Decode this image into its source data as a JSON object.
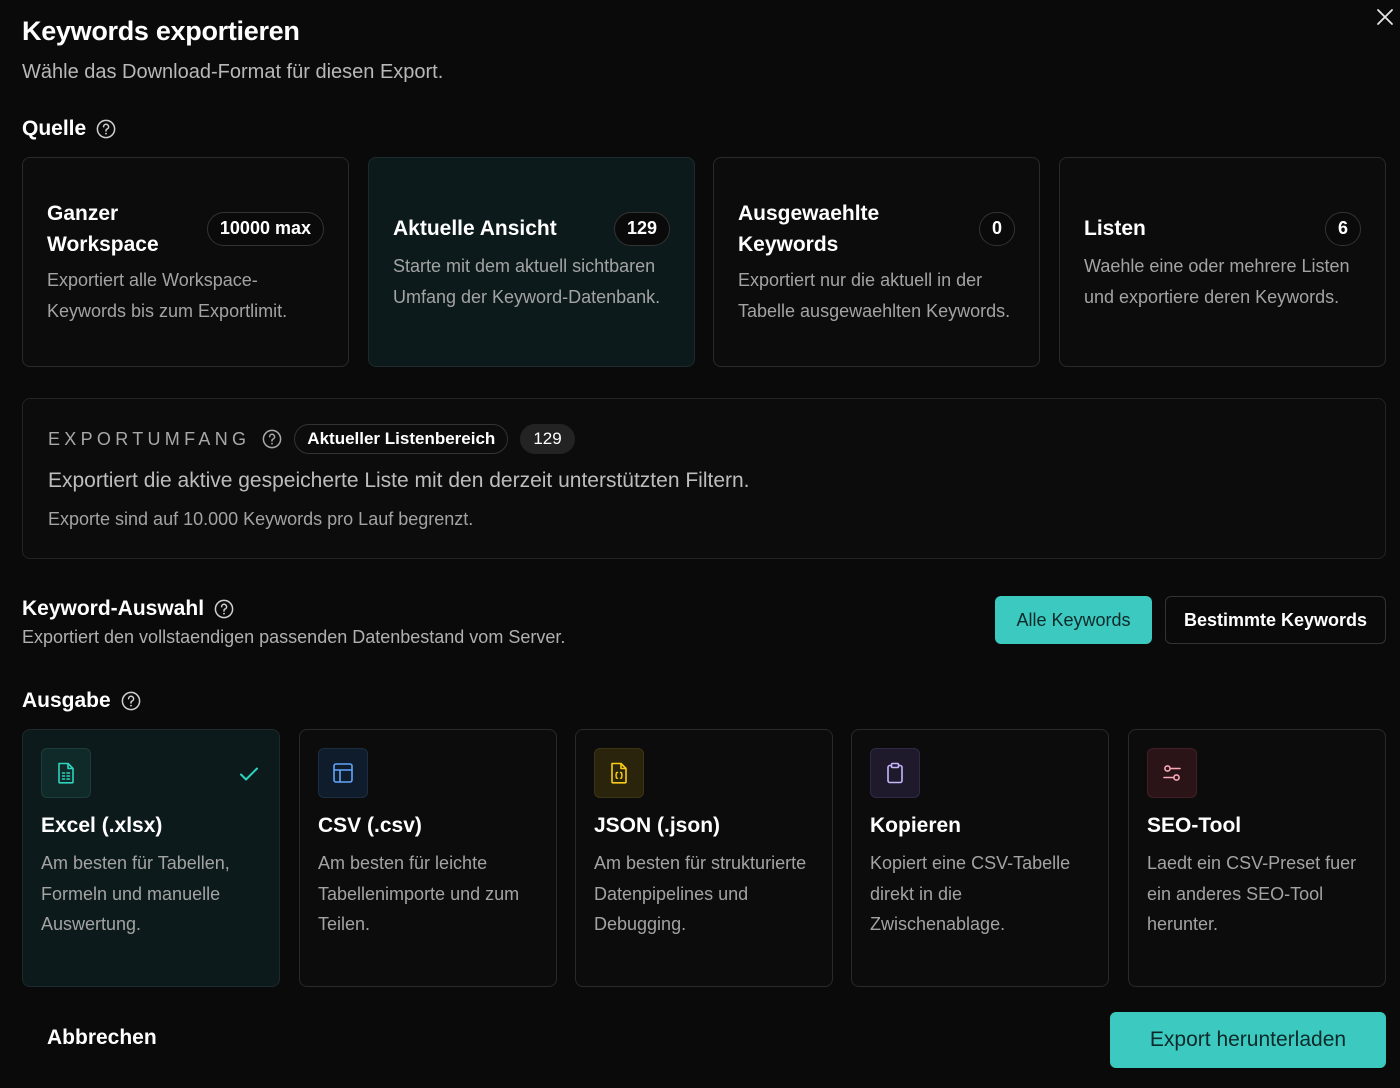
{
  "dialog": {
    "title": "Keywords exportieren",
    "subtitle": "Wähle das Download-Format für diesen Export."
  },
  "source": {
    "heading": "Quelle",
    "cards": [
      {
        "title": "Ganzer Workspace",
        "badge": "10000 max",
        "description": "Exportiert alle Workspace-Keywords bis zum Exportlimit.",
        "active": false
      },
      {
        "title": "Aktuelle Ansicht",
        "badge": "129",
        "description": "Starte mit dem aktuell sichtbaren Umfang der Keyword-Datenbank.",
        "active": true
      },
      {
        "title": "Ausgewaehlte Keywords",
        "badge": "0",
        "description": "Exportiert nur die aktuell in der Tabelle ausgewaehlten Keywords.",
        "active": false
      },
      {
        "title": "Listen",
        "badge": "6",
        "description": "Waehle eine oder mehrere Listen und exportiere deren Keywords.",
        "active": false
      }
    ]
  },
  "scope": {
    "label": "EXPORTUMFANG",
    "pill": "Aktueller Listenbereich",
    "count": "129",
    "description": "Exportiert die aktive gespeicherte Liste mit den derzeit unterstützten Filtern.",
    "note": "Exporte sind auf 10.000 Keywords pro Lauf begrenzt."
  },
  "keyword_selection": {
    "heading": "Keyword-Auswahl",
    "description": "Exportiert den vollstaendigen passenden Datenbestand vom Server.",
    "options": [
      "Alle Keywords",
      "Bestimmte Keywords"
    ],
    "selected": "Alle Keywords"
  },
  "output": {
    "heading": "Ausgabe",
    "formats": [
      {
        "title": "Excel (.xlsx)",
        "description": "Am besten für Tabellen, Formeln und manuelle Auswertung.",
        "icon": "spreadsheet-icon",
        "color": "#2dd4bf",
        "active": true
      },
      {
        "title": "CSV (.csv)",
        "description": "Am besten für leichte Tabellenimporte und zum Teilen.",
        "icon": "table-icon",
        "color": "#60a5fa",
        "active": false
      },
      {
        "title": "JSON (.json)",
        "description": "Am besten für strukturierte Datenpipelines und Debugging.",
        "icon": "code-file-icon",
        "color": "#facc15",
        "active": false
      },
      {
        "title": "Kopieren",
        "description": "Kopiert eine CSV-Tabelle direkt in die Zwischenablage.",
        "icon": "clipboard-icon",
        "color": "#c4b5fd",
        "active": false
      },
      {
        "title": "SEO-Tool",
        "description": "Laedt ein CSV-Preset fuer ein anderes SEO-Tool herunter.",
        "icon": "settings-sliders-icon",
        "color": "#f9a8b4",
        "active": false
      }
    ]
  },
  "footer": {
    "cancel_label": "Abbrechen",
    "export_label": "Export herunterladen"
  },
  "colors": {
    "accent": "#3cc9c0",
    "background": "#0a0a0a"
  }
}
